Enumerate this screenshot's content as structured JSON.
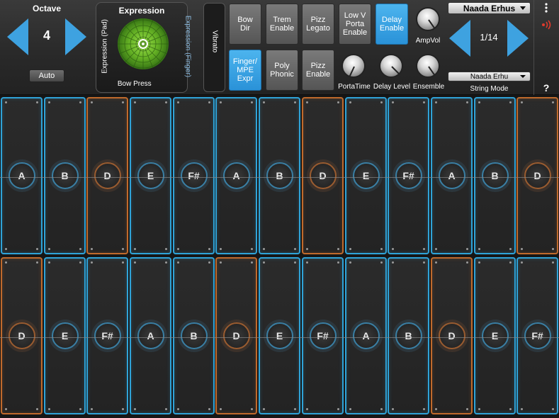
{
  "octave": {
    "label": "Octave",
    "value": "4",
    "auto_label": "Auto"
  },
  "expression": {
    "title": "Expression",
    "left_axis": "Expression (Pad)",
    "right_axis": "Expression (Finger)",
    "bottom_label": "Bow Press"
  },
  "vibrato": {
    "label": "Vibrato"
  },
  "buttons": [
    {
      "label": "Bow\nDir",
      "active": false
    },
    {
      "label": "Trem\nEnable",
      "active": false
    },
    {
      "label": "Pizz\nLegato",
      "active": false
    },
    {
      "label": "Low V\nPorta\nEnable",
      "active": false
    },
    {
      "label": "Delay\nEnable",
      "active": true
    },
    {
      "label": "Finger/\nMPE\nExpr",
      "active": true
    },
    {
      "label": "Poly\nPhonic",
      "active": false
    },
    {
      "label": "Pizz\nEnable",
      "active": false
    }
  ],
  "knobs": {
    "ampvol": "AmpVol",
    "portatime": "PortaTime",
    "delay_level": "Delay Level",
    "ensemble": "Ensemble"
  },
  "preset": {
    "name": "Naada Erhus",
    "counter": "1/14",
    "mode_select": "Naada Erhu",
    "mode_label": "String Mode"
  },
  "icons": {
    "menu": "more-vertical-icon",
    "midi": "wireless-icon",
    "help": "?"
  },
  "colors": {
    "accent": "#3ea2e0",
    "cell_blue": "#2fa3d8",
    "cell_orange": "#c06a2c"
  },
  "rows": [
    {
      "notes": [
        "A",
        "B",
        "D",
        "E",
        "F#",
        "A",
        "B",
        "D",
        "E",
        "F#",
        "A",
        "B",
        "D"
      ],
      "orange": [
        false,
        false,
        true,
        false,
        false,
        false,
        false,
        true,
        false,
        false,
        false,
        false,
        true
      ]
    },
    {
      "notes": [
        "D",
        "E",
        "F#",
        "A",
        "B",
        "D",
        "E",
        "F#",
        "A",
        "B",
        "D",
        "E",
        "F#"
      ],
      "orange": [
        true,
        false,
        false,
        false,
        false,
        true,
        false,
        false,
        false,
        false,
        true,
        false,
        false
      ]
    }
  ]
}
